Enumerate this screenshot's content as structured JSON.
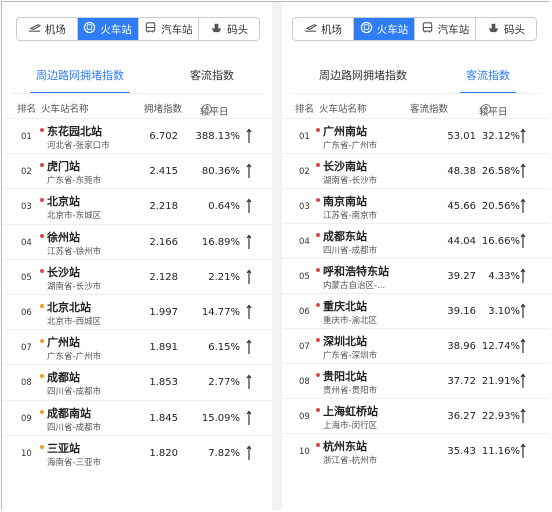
{
  "tabs": [
    {
      "label": "机场",
      "icon": "plane-icon"
    },
    {
      "label": "火车站",
      "icon": "train-icon"
    },
    {
      "label": "汽车站",
      "icon": "bus-icon"
    },
    {
      "label": "码头",
      "icon": "ship-icon"
    }
  ],
  "active_tab": "火车站",
  "colors": {
    "accent": "#2f7df6",
    "dot_red": "#e04848",
    "dot_orange": "#f0a020"
  },
  "left": {
    "sub_tabs": [
      "周边路网拥堵指数",
      "客流指数"
    ],
    "active_sub_tab": 0,
    "headers": {
      "rank": "排名",
      "name": "火车站名称",
      "value": "拥堵指数",
      "compare": "较平日"
    },
    "rows": [
      {
        "rank": "01",
        "name": "东花园北站",
        "city": "河北省-张家口市",
        "value": "6.702",
        "pct": "388.13%",
        "dot": "red"
      },
      {
        "rank": "02",
        "name": "虎门站",
        "city": "广东省-东莞市",
        "value": "2.415",
        "pct": "80.36%",
        "dot": "red"
      },
      {
        "rank": "03",
        "name": "北京站",
        "city": "北京市-东城区",
        "value": "2.218",
        "pct": "0.64%",
        "dot": "red"
      },
      {
        "rank": "04",
        "name": "徐州站",
        "city": "江苏省-徐州市",
        "value": "2.166",
        "pct": "16.89%",
        "dot": "red"
      },
      {
        "rank": "05",
        "name": "长沙站",
        "city": "湖南省-长沙市",
        "value": "2.128",
        "pct": "2.21%",
        "dot": "red"
      },
      {
        "rank": "06",
        "name": "北京北站",
        "city": "北京市-西城区",
        "value": "1.997",
        "pct": "14.77%",
        "dot": "orange"
      },
      {
        "rank": "07",
        "name": "广州站",
        "city": "广东省-广州市",
        "value": "1.891",
        "pct": "6.15%",
        "dot": "orange"
      },
      {
        "rank": "08",
        "name": "成都站",
        "city": "四川省-成都市",
        "value": "1.853",
        "pct": "2.77%",
        "dot": "orange"
      },
      {
        "rank": "09",
        "name": "成都南站",
        "city": "四川省-成都市",
        "value": "1.845",
        "pct": "15.09%",
        "dot": "orange"
      },
      {
        "rank": "10",
        "name": "三亚站",
        "city": "海南省-三亚市",
        "value": "1.820",
        "pct": "7.82%",
        "dot": "orange"
      }
    ]
  },
  "right": {
    "sub_tabs": [
      "周边路网拥堵指数",
      "客流指数"
    ],
    "active_sub_tab": 1,
    "headers": {
      "rank": "排名",
      "name": "火车站名称",
      "value": "客流指数",
      "compare": "较平日"
    },
    "rows": [
      {
        "rank": "01",
        "name": "广州南站",
        "city": "广东省-广州市",
        "value": "53.01",
        "pct": "32.12%",
        "dot": "red"
      },
      {
        "rank": "02",
        "name": "长沙南站",
        "city": "湖南省-长沙市",
        "value": "48.38",
        "pct": "26.58%",
        "dot": "red"
      },
      {
        "rank": "03",
        "name": "南京南站",
        "city": "江苏省-南京市",
        "value": "45.66",
        "pct": "20.56%",
        "dot": "red"
      },
      {
        "rank": "04",
        "name": "成都东站",
        "city": "四川省-成都市",
        "value": "44.04",
        "pct": "16.66%",
        "dot": "red"
      },
      {
        "rank": "05",
        "name": "呼和浩特东站",
        "city": "内蒙古自治区-...",
        "value": "39.27",
        "pct": "4.33%",
        "dot": "red"
      },
      {
        "rank": "06",
        "name": "重庆北站",
        "city": "重庆市-渝北区",
        "value": "39.16",
        "pct": "3.10%",
        "dot": "red"
      },
      {
        "rank": "07",
        "name": "深圳北站",
        "city": "广东省-深圳市",
        "value": "38.96",
        "pct": "12.74%",
        "dot": "red"
      },
      {
        "rank": "08",
        "name": "贵阳北站",
        "city": "贵州省-贵阳市",
        "value": "37.72",
        "pct": "21.91%",
        "dot": "red"
      },
      {
        "rank": "09",
        "name": "上海虹桥站",
        "city": "上海市-闵行区",
        "value": "36.27",
        "pct": "22.93%",
        "dot": "red"
      },
      {
        "rank": "10",
        "name": "杭州东站",
        "city": "浙江省-杭州市",
        "value": "35.43",
        "pct": "11.16%",
        "dot": "red"
      }
    ]
  }
}
